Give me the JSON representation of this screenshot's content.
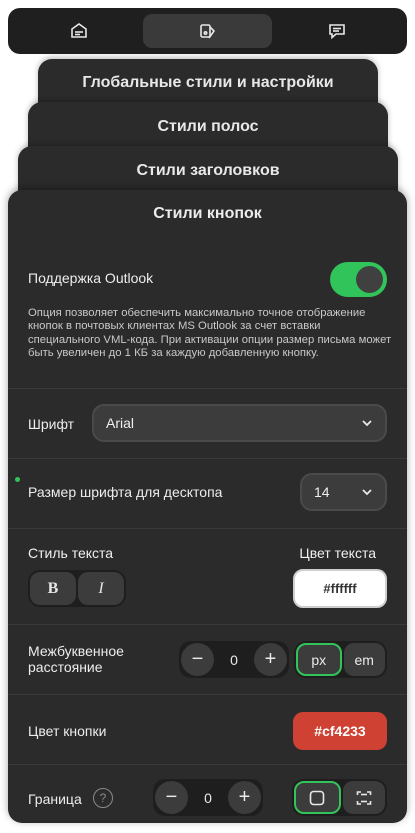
{
  "topbar": {
    "tabs": [
      {
        "icon": "template-icon",
        "active": false
      },
      {
        "icon": "paint-design-icon",
        "active": true
      },
      {
        "icon": "message-icon",
        "active": false
      }
    ]
  },
  "stacked_panels": {
    "global": "Глобальные стили и настройки",
    "stripes": "Стили полос",
    "headings": "Стили заголовков"
  },
  "main": {
    "title": "Стили кнопок",
    "outlook": {
      "label": "Поддержка Outlook",
      "enabled": true,
      "description": "Опция позволяет обеспечить максимально точное отображение кнопок в почтовых клиентах MS Outlook за счет вставки специального VML-кода. При активации опции размер письма может быть увеличен до 1 КБ за каждую добавленную кнопку."
    },
    "font": {
      "label": "Шрифт",
      "value": "Arial"
    },
    "font_size": {
      "label": "Размер шрифта для десктопа",
      "value": "14"
    },
    "text_style": {
      "label": "Стиль текста",
      "bold": "B",
      "italic": "I",
      "color_label": "Цвет текста",
      "color_value": "#ffffff"
    },
    "letter_spacing": {
      "label": "Межбуквенное расстояние",
      "minus": "−",
      "value": "0",
      "plus": "+",
      "unit_px": "px",
      "unit_em": "em",
      "selected_unit": "px"
    },
    "button_color": {
      "label": "Цвет кнопки",
      "value": "#cf4233"
    },
    "border": {
      "label": "Граница",
      "help": "?",
      "minus": "−",
      "value": "0",
      "plus": "+"
    }
  },
  "colors": {
    "accent": "#31c45a",
    "panel": "#2b2b2b",
    "button_red": "#cf4233"
  }
}
